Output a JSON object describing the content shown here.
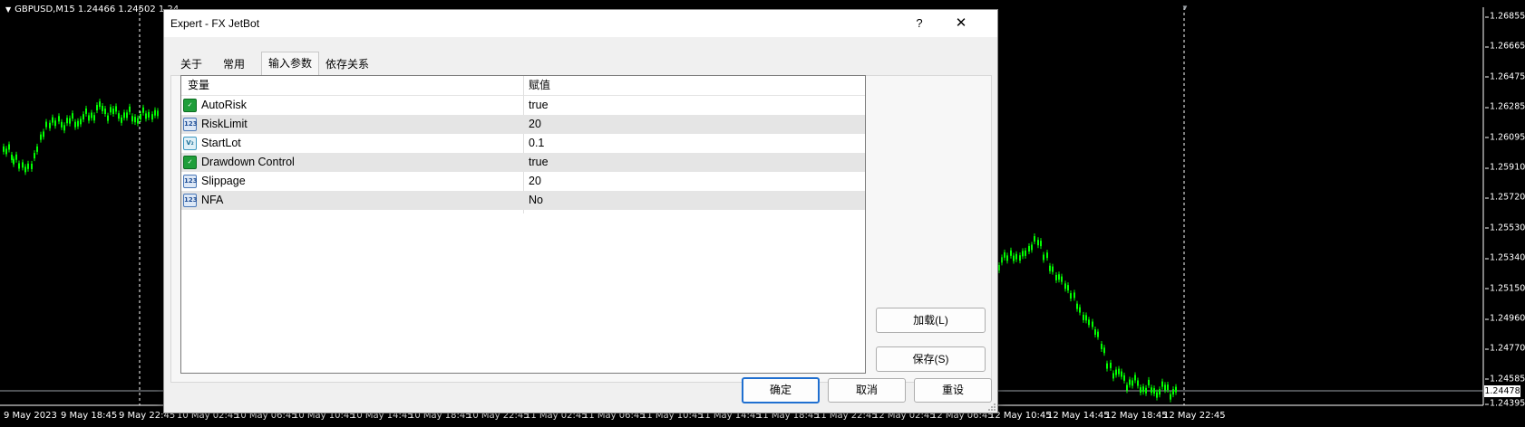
{
  "chart": {
    "symbol_line": "GBPUSD,M15  1.24466 1.24502 1.24",
    "price_labels": [
      "1.26855",
      "1.26665",
      "1.26475",
      "1.26285",
      "1.26095",
      "1.25910",
      "1.25720",
      "1.25530",
      "1.25340",
      "1.25150",
      "1.24960",
      "1.24770",
      "1.24585",
      "1.24395"
    ],
    "current_price": "1.24478",
    "time_labels": [
      "9 May 2023",
      "9 May 18:45",
      "9 May 22:45",
      "10 May 02:45",
      "10 May 06:45",
      "10 May 10:45",
      "10 May 14:45",
      "10 May 18:45",
      "10 May 22:45",
      "11 May 02:45",
      "11 May 06:45",
      "11 May 10:45",
      "11 May 14:45",
      "11 May 18:45",
      "11 May 22:45",
      "12 May 02:45",
      "12 May 06:45",
      "12 May 10:45",
      "12 May 14:45",
      "12 May 18:45",
      "12 May 22:45"
    ],
    "colors": {
      "candle": "#00ff00",
      "background": "#000000",
      "grid": "#ffffff"
    }
  },
  "dialog": {
    "title": "Expert - FX JetBot",
    "help_symbol": "?",
    "close_symbol": "✕",
    "tabs": [
      {
        "label": "关于",
        "active": false
      },
      {
        "label": "常用",
        "active": false
      },
      {
        "label": "输入参数",
        "active": true
      },
      {
        "label": "依存关系",
        "active": false
      }
    ],
    "columns": {
      "variable": "变量",
      "value": "赋值"
    },
    "params": [
      {
        "name": "AutoRisk",
        "value": "true",
        "icon": "bool-icon",
        "icon_text": "✓"
      },
      {
        "name": "RiskLimit",
        "value": "20",
        "icon": "int-icon",
        "icon_text": "123"
      },
      {
        "name": "StartLot",
        "value": "0.1",
        "icon": "double-icon",
        "icon_text": "V₂"
      },
      {
        "name": "Drawdown Control",
        "value": "true",
        "icon": "bool-icon",
        "icon_text": "✓"
      },
      {
        "name": "Slippage",
        "value": "20",
        "icon": "int-icon",
        "icon_text": "123"
      },
      {
        "name": "NFA",
        "value": "No",
        "icon": "int-icon",
        "icon_text": "123"
      }
    ],
    "buttons": {
      "load": "加载(L)",
      "save": "保存(S)",
      "ok": "确定",
      "cancel": "取消",
      "reset": "重设"
    }
  }
}
